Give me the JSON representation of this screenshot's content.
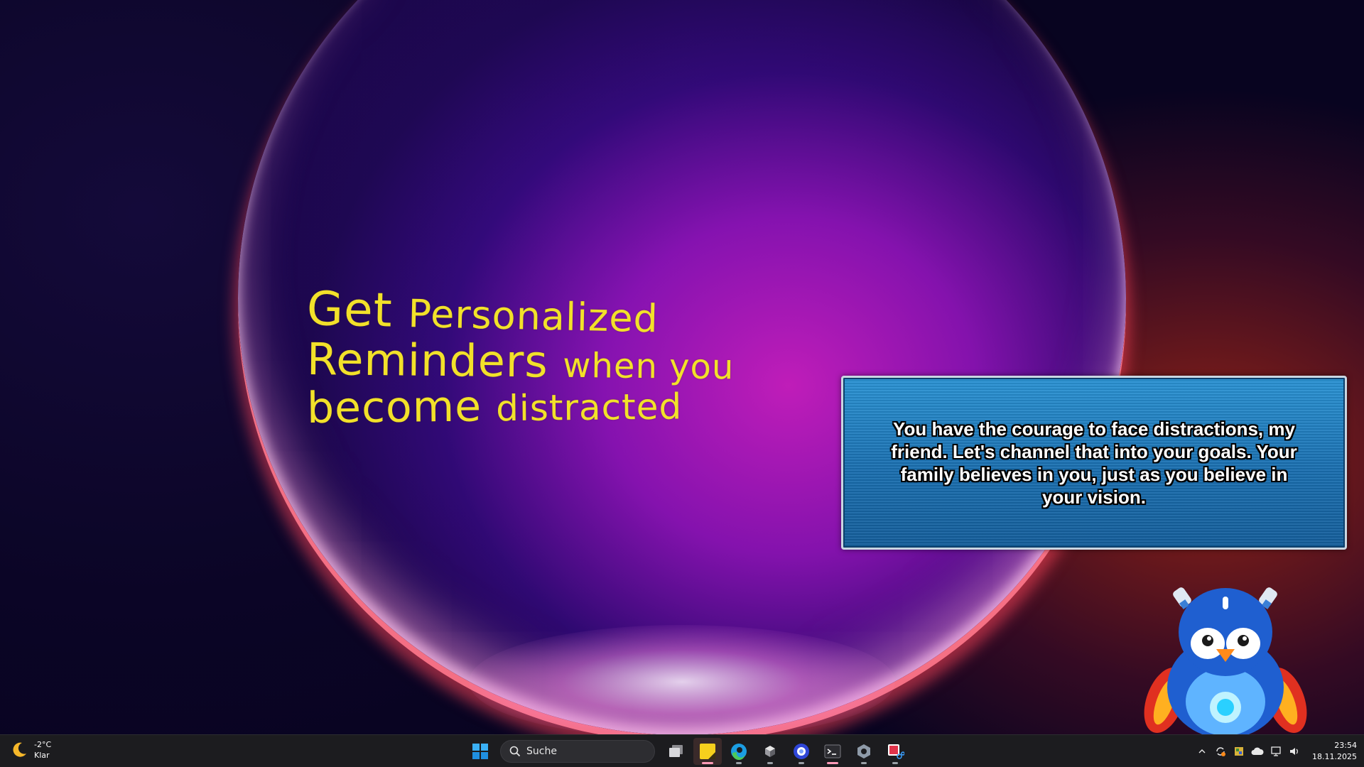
{
  "headline": {
    "line1_big": "Get",
    "line1_small": "Personalized",
    "line2_big": "Reminders",
    "line2_small": "when you",
    "line3_big": "become",
    "line3_small": "distracted"
  },
  "panel": {
    "message": "You have the courage to face distractions, my friend. Let's channel that into your goals. Your family believes in you, just as you believe in your vision."
  },
  "weather": {
    "icon": "moon-icon",
    "temperature": "-2°C",
    "condition": "Klar"
  },
  "taskbar": {
    "search_placeholder": "Suche",
    "apps": [
      {
        "name": "task-view",
        "icon": "task-view-icon"
      },
      {
        "name": "sticky-notes",
        "icon": "sticky-notes-icon",
        "active": true
      },
      {
        "name": "edge",
        "icon": "edge-icon"
      },
      {
        "name": "app-cube",
        "icon": "cube-icon"
      },
      {
        "name": "app-circle",
        "icon": "circle-app-icon"
      },
      {
        "name": "terminal",
        "icon": "terminal-icon"
      },
      {
        "name": "settings-gear",
        "icon": "gear-app-icon"
      },
      {
        "name": "snipping-tool",
        "icon": "snipping-icon"
      }
    ]
  },
  "tray": {
    "time": "23:54",
    "date": "18.11.2025"
  },
  "colors": {
    "headline": "#f2e12a",
    "panel": "#1a6fb0",
    "taskbar": "#1c1c1f"
  }
}
